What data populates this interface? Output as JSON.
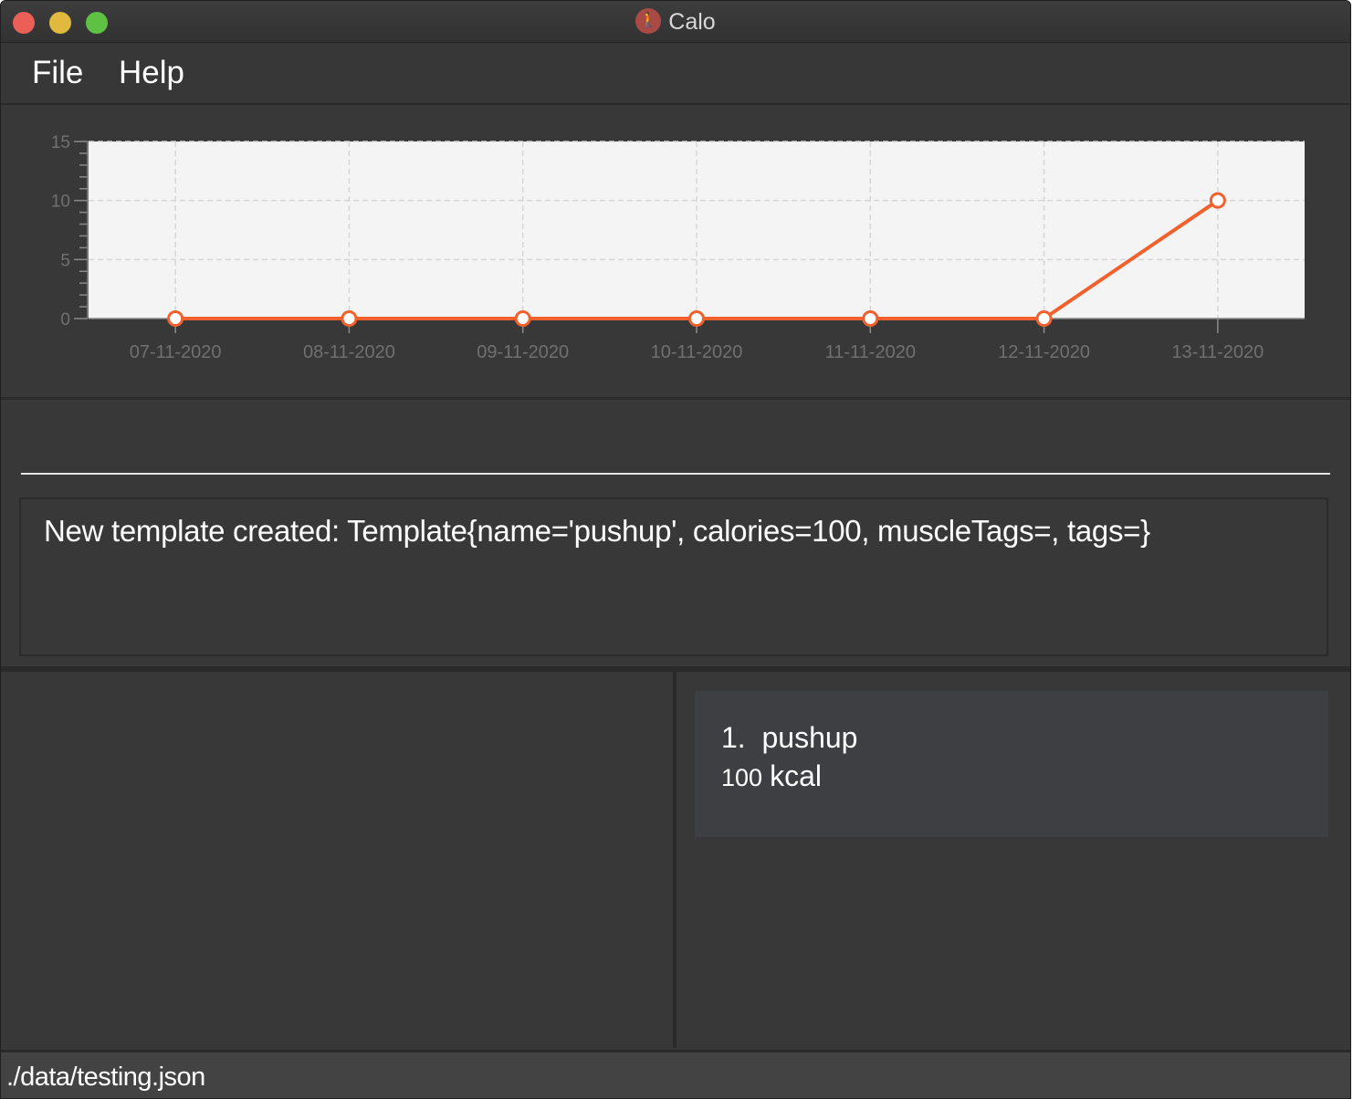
{
  "window": {
    "title": "Calo",
    "app_icon": "running-person-icon"
  },
  "menu": {
    "file": "File",
    "help": "Help"
  },
  "chart_data": {
    "type": "line",
    "categories": [
      "07-11-2020",
      "08-11-2020",
      "09-11-2020",
      "10-11-2020",
      "11-11-2020",
      "12-11-2020",
      "13-11-2020"
    ],
    "series": [
      {
        "values": [
          0,
          0,
          0,
          0,
          0,
          0,
          10
        ],
        "color": "#f0612e"
      }
    ],
    "ylim": [
      0,
      15
    ],
    "yticks": [
      0,
      5,
      10,
      15
    ],
    "grid": true,
    "xlabel": "",
    "ylabel": "",
    "title": ""
  },
  "command": {
    "value": "",
    "placeholder": ""
  },
  "result": {
    "text": "New template created: Template{name='pushup', calories=100, muscleTags=, tags=}"
  },
  "templates": [
    {
      "index": "1.",
      "name": "pushup",
      "calories": "100",
      "unit": "kcal"
    }
  ],
  "status": {
    "path": "./data/testing.json"
  }
}
